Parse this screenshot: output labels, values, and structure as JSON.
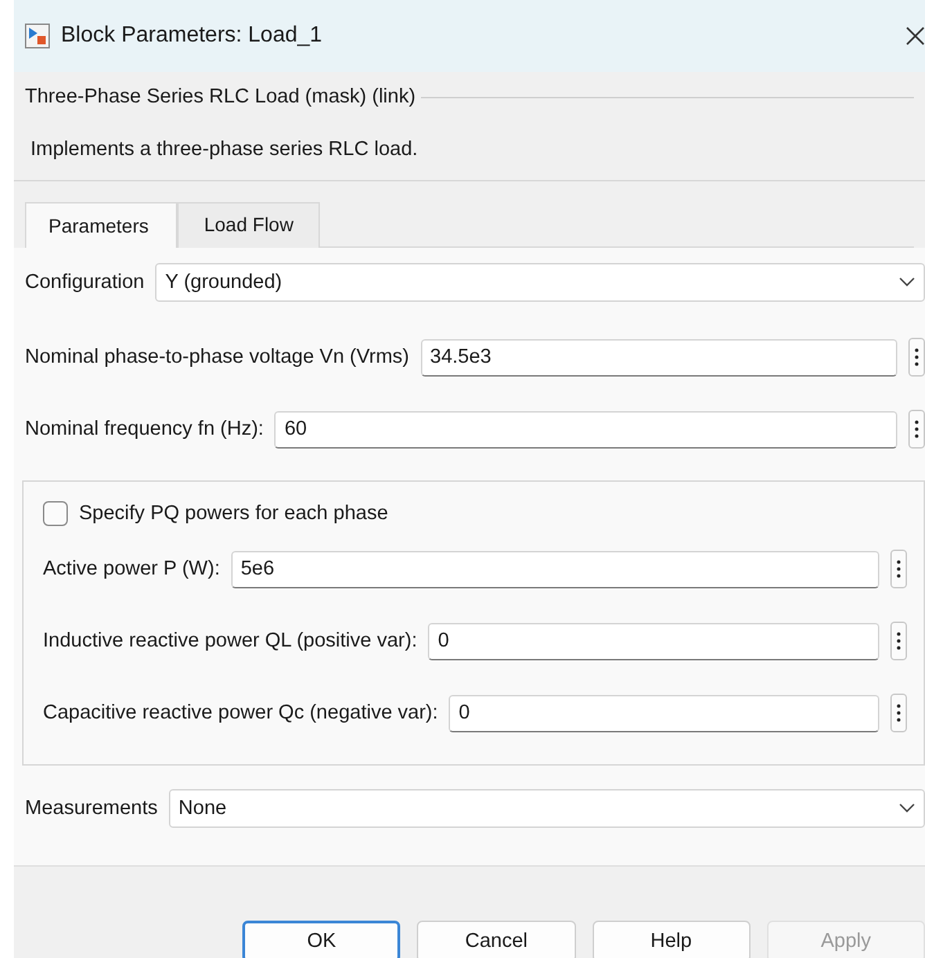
{
  "window": {
    "title": "Block Parameters: Load_1"
  },
  "mask": {
    "title": "Three-Phase Series RLC Load (mask) (link)",
    "description": "Implements a three-phase series RLC load."
  },
  "tabs": [
    {
      "label": "Parameters",
      "selected": true
    },
    {
      "label": "Load Flow",
      "selected": false
    }
  ],
  "parameters": [
    {
      "kind": "dropdown",
      "label": "Configuration",
      "value": "Y (grounded)"
    },
    {
      "kind": "field",
      "label": "Nominal phase-to-phase voltage Vn (Vrms)",
      "value": "34.5e3"
    },
    {
      "kind": "field",
      "label": "Nominal frequency fn (Hz):",
      "value": "60"
    },
    {
      "kind": "group",
      "checkbox": {
        "label": "Specify PQ powers for each phase",
        "checked": false
      },
      "children": [
        {
          "kind": "field",
          "label": "Active power P (W):",
          "value": "5e6"
        },
        {
          "kind": "field",
          "label": "Inductive reactive power QL (positive var):",
          "value": "0"
        },
        {
          "kind": "field",
          "label": "Capacitive reactive power Qc (negative var):",
          "value": "0"
        }
      ]
    },
    {
      "kind": "dropdown",
      "label": "Measurements",
      "value": "None"
    }
  ],
  "buttons": [
    {
      "label": "OK",
      "default": true,
      "disabled": false
    },
    {
      "label": "Cancel",
      "default": false,
      "disabled": false
    },
    {
      "label": "Help",
      "default": false,
      "disabled": false
    },
    {
      "label": "Apply",
      "default": false,
      "disabled": true
    }
  ]
}
